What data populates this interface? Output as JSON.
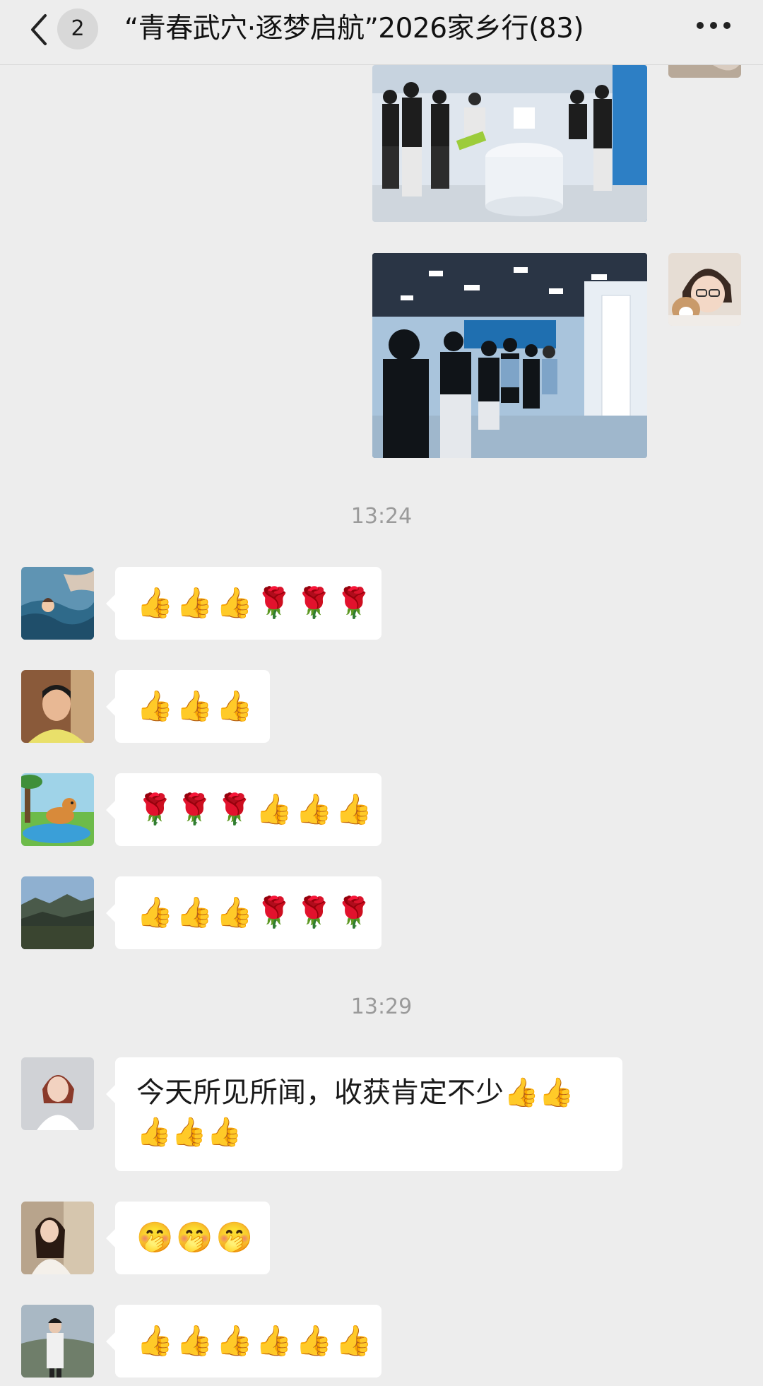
{
  "header": {
    "unread_count": "2",
    "title": "“青春武穴·逐梦启航”2026家乡行(83)"
  },
  "timestamps": [
    "13:24",
    "13:29"
  ],
  "messages": [
    {
      "emoji": "👍👍👍🌹🌹🌹"
    },
    {
      "emoji": "👍👍👍"
    },
    {
      "emoji": "🌹🌹🌹👍👍👍"
    },
    {
      "emoji": "👍👍👍🌹🌹🌹"
    },
    {
      "text": "今天所见所闻，收获肯定不少👍👍👍👍👍"
    },
    {
      "emoji": "🤭🤭🤭"
    },
    {
      "emoji": "👍👍👍👍👍👍"
    }
  ],
  "colors": {
    "background": "#ededed",
    "bubble": "#ffffff",
    "timestamp": "#9a9a9a"
  },
  "icons": [
    "chevron-left-icon",
    "more-dots-icon"
  ]
}
